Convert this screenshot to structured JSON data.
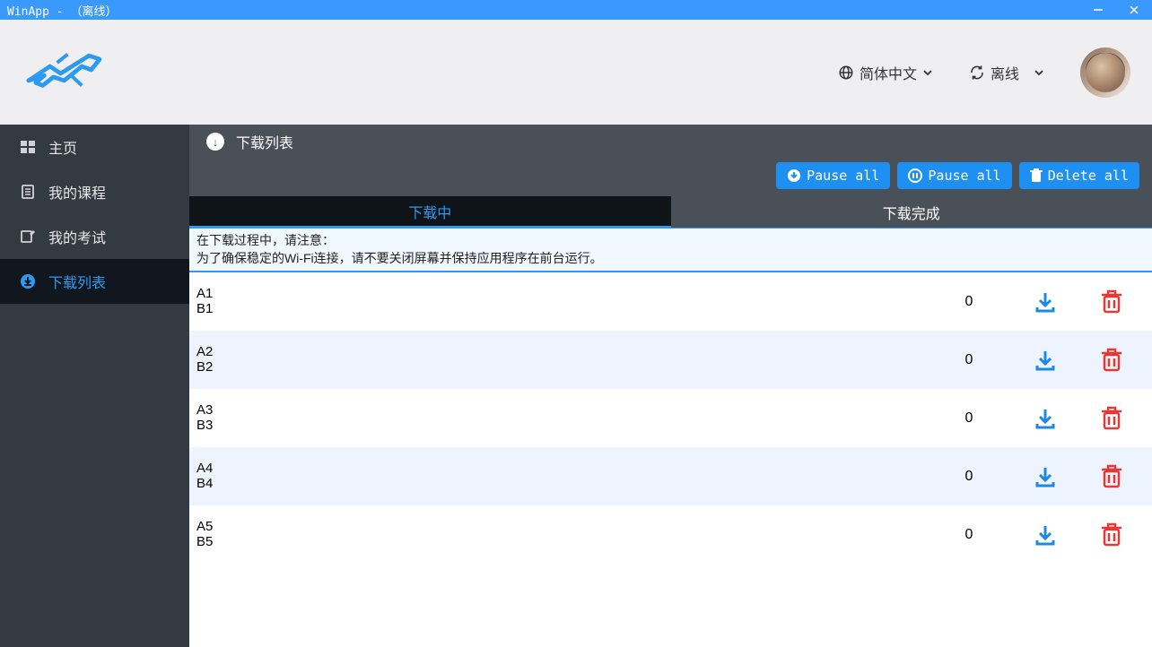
{
  "window": {
    "title": "WinApp - （离线）"
  },
  "header": {
    "language_label": "简体中文",
    "status_label": "离线"
  },
  "sidebar": {
    "items": [
      {
        "icon": "windows-icon",
        "label": "主页"
      },
      {
        "icon": "book-icon",
        "label": "我的课程"
      },
      {
        "icon": "edit-icon",
        "label": "我的考试"
      },
      {
        "icon": "download-circle-icon",
        "label": "下载列表"
      }
    ],
    "active_index": 3
  },
  "page": {
    "title": "下载列表",
    "toolbar": {
      "pause_all_down": "Pause all",
      "pause_all": "Pause all",
      "delete_all": "Delete all"
    },
    "tabs": [
      {
        "label": "下载中",
        "active": true
      },
      {
        "label": "下载完成",
        "active": false
      }
    ],
    "notice_line1": "在下载过程中，请注意：",
    "notice_line2": "为了确保稳定的Wi-Fi连接，请不要关闭屏幕并保持应用程序在前台运行。",
    "rows": [
      {
        "line1": "A1",
        "line2": "B1",
        "count": "0"
      },
      {
        "line1": "A2",
        "line2": "B2",
        "count": "0"
      },
      {
        "line1": "A3",
        "line2": "B3",
        "count": "0"
      },
      {
        "line1": "A4",
        "line2": "B4",
        "count": "0"
      },
      {
        "line1": "A5",
        "line2": "B5",
        "count": "0"
      }
    ]
  },
  "colors": {
    "accent": "#2d9af2",
    "titlebar": "#3a99fc",
    "sidebar": "#333a41",
    "sidebar_active": "#10171e",
    "toolbar_btn": "#1e90f2",
    "delete_red": "#e53935"
  }
}
